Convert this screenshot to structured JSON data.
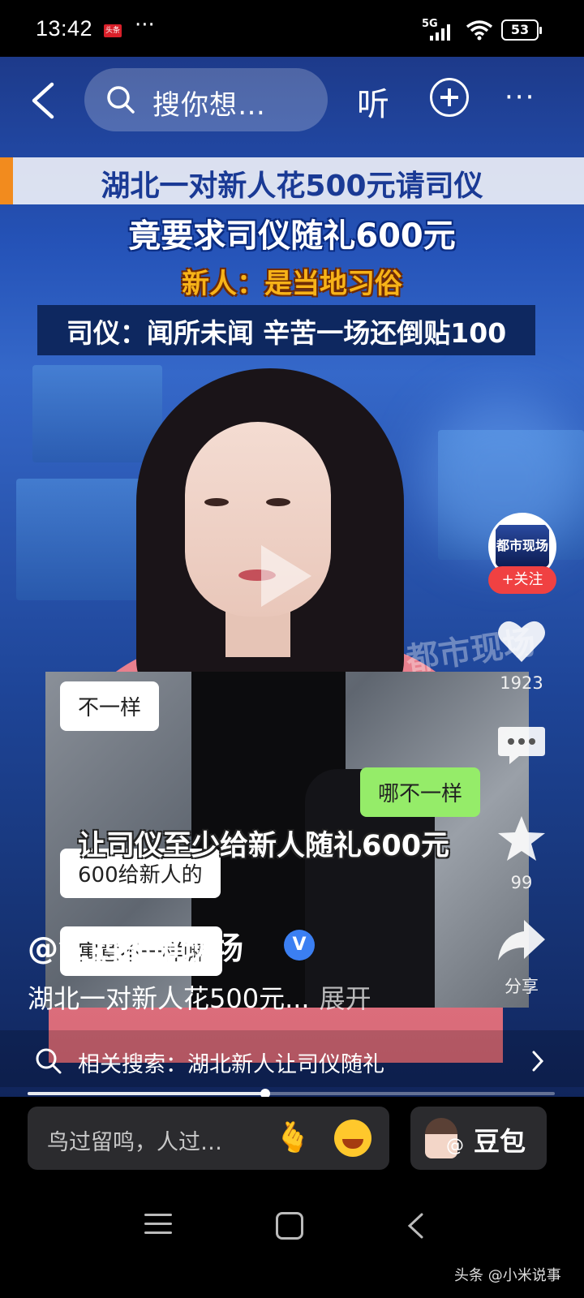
{
  "status_bar": {
    "time": "13:42",
    "app_badge": "头条",
    "more": "···",
    "network": "5G",
    "battery": "53"
  },
  "top_nav": {
    "search_placeholder": "搜你想…",
    "listen_label": "听",
    "icons": [
      "back-icon",
      "search-icon",
      "plus-icon",
      "more-icon"
    ]
  },
  "video": {
    "headline_1": "湖北一对新人花500元请司仪",
    "headline_2": "竟要求司仪随礼600元",
    "headline_3": "新人：是当地习俗",
    "headline_4": "司仪：闻所未闻 辛苦一场还倒贴100",
    "watermark": "都市现场",
    "chat": {
      "bubble_1": "不一样",
      "bubble_2": "哪不一样",
      "bubble_3": "600给新人的",
      "bubble_4": "寓意不一样嘛"
    },
    "caption": "让司仪至少给新人随礼600元"
  },
  "rail": {
    "avatar_text": "都市现场",
    "follow_label": "+关注",
    "likes": "1923",
    "favorites": "99",
    "share_label": "分享"
  },
  "post": {
    "author": "@江西都市现场",
    "verified_badge": "V",
    "description": "湖北一对新人花500元...",
    "expand_label": "展开"
  },
  "related_search": {
    "text": "相关搜索：湖北新人让司仪随礼"
  },
  "progress": {
    "fraction": 0.45
  },
  "comment_bar": {
    "placeholder": "鸟过留鸣，人过…",
    "doubao_label": "豆包",
    "doubao_at": "@"
  },
  "footer": {
    "credit": "头条 @小米说事"
  },
  "colors": {
    "follow_red": "#f04142",
    "verified_blue": "#3b7ff2",
    "chat_green": "#95ec69",
    "headline_orange": "#f7b318"
  }
}
